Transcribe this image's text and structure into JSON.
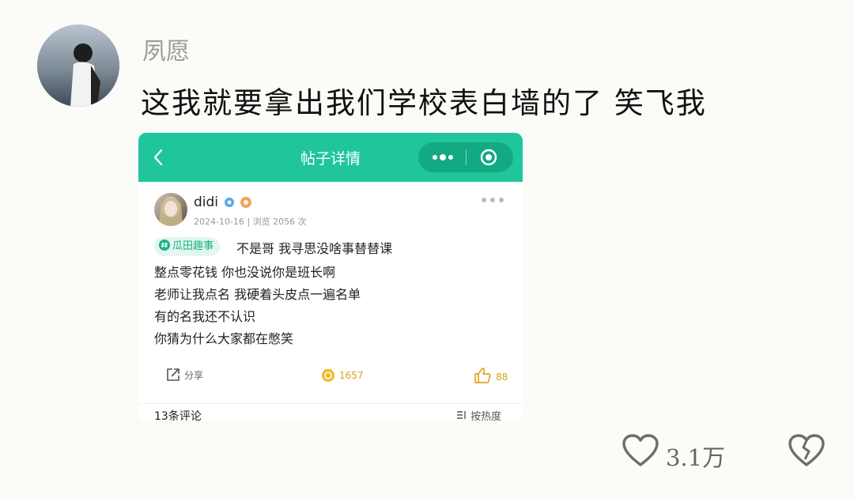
{
  "comment": {
    "username": "夙愿",
    "text": "这我就要拿出我们学校表白墙的了 笑飞我"
  },
  "card": {
    "title": "帖子详情",
    "back_icon": "chevron-left-icon",
    "capsule_icons": [
      "more-dots-icon",
      "target-icon"
    ],
    "post": {
      "author": "didi",
      "date": "2024-10-16",
      "views": "浏览 2056 次",
      "tag": "瓜田趣事",
      "lines": [
        "不是哥 我寻思没啥事替替课",
        "整点零花钱 你也没说你是班长啊",
        "老师让我点名 我硬着头皮点一遍名单",
        "有的名我还不认识",
        "你猜为什么大家都在憋笑"
      ],
      "share_label": "分享",
      "coin_count": "1657",
      "like_count": "88"
    },
    "comment_count": "13条评论",
    "sort_label": "按热度"
  },
  "footer": {
    "likes": "3.1万"
  },
  "colors": {
    "header": "#21c59b",
    "accent": "#d9a21b",
    "tag_bg": "#e3f6ef"
  }
}
